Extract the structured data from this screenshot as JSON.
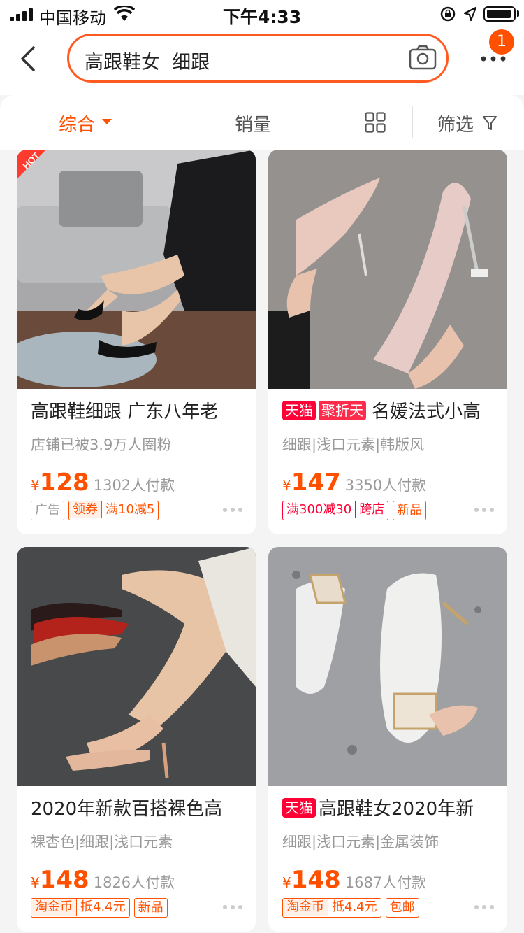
{
  "status_bar": {
    "carrier": "中国移动",
    "time": "下午4:33"
  },
  "search": {
    "query": "高跟鞋女  细跟",
    "notification_count": "1"
  },
  "filters": {
    "comprehensive": "综合",
    "sales": "销量",
    "filter": "筛选"
  },
  "products": [
    {
      "title": "高跟鞋细跟 广东八年老",
      "subtitle": "店铺已被3.9万人圈粉",
      "price_symbol": "¥",
      "price": "128",
      "sold": "1302人付款",
      "badge": "HOT",
      "tag_ad": "广告",
      "tag_coupon_a": "领券",
      "tag_coupon_b": "满10减5"
    },
    {
      "brand_tag": "天猫",
      "promo_tag": "聚折天",
      "title": "名媛法式小高",
      "subtitle": "细跟|浅口元素|韩版风",
      "price_symbol": "¥",
      "price": "147",
      "sold": "3350人付款",
      "tag_discount_a": "满300减30",
      "tag_discount_b": "跨店",
      "tag_new": "新品"
    },
    {
      "title": "2020年新款百搭裸色高",
      "subtitle": "裸杏色|细跟|浅口元素",
      "price_symbol": "¥",
      "price": "148",
      "sold": "1826人付款",
      "tag_coin_a": "淘金币",
      "tag_coin_b": "抵4.4元",
      "tag_new": "新品"
    },
    {
      "brand_tag": "天猫",
      "title": "高跟鞋女2020年新",
      "subtitle": "细跟|浅口元素|金属装饰",
      "price_symbol": "¥",
      "price": "148",
      "sold": "1687人付款",
      "tag_coin_a": "淘金币",
      "tag_coin_b": "抵4.4元",
      "tag_shipping": "包邮"
    }
  ],
  "colors": {
    "accent": "#ff5000",
    "tmall_red": "#ff0036"
  }
}
